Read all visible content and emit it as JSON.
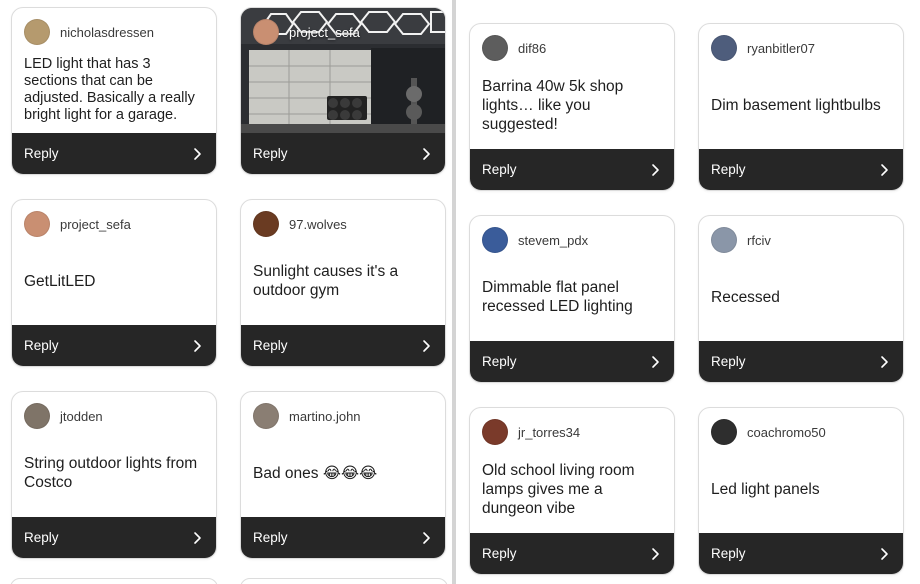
{
  "left_cards": [
    {
      "user": "nicholasdressen",
      "text": "LED light that has 3 sections that can be adjusted. Basically a really bright light for a garage.",
      "avatar_color": "#b59a6e",
      "avatar_icon": "user-avatar"
    },
    {
      "user": "project_sefa",
      "text": "",
      "avatar_color": "#c98f72",
      "avatar_icon": "user-avatar",
      "photo": "garage-gym-photo"
    },
    {
      "user": "project_sefa",
      "text": "GetLitLED",
      "avatar_color": "#c98f72",
      "avatar_icon": "user-avatar"
    },
    {
      "user": "97.wolves",
      "text": "Sunlight causes it's a outdoor gym",
      "avatar_color": "#6a3b22",
      "avatar_icon": "user-avatar"
    },
    {
      "user": "jtodden",
      "text": "String outdoor lights from Costco",
      "avatar_color": "#7f7468",
      "avatar_icon": "user-avatar"
    },
    {
      "user": "martino.john",
      "text": "Bad ones 😂😂😂",
      "avatar_color": "#8a7e73",
      "avatar_icon": "user-avatar"
    }
  ],
  "right_cards": [
    {
      "user": "dif86",
      "text": "Barrina 40w 5k shop lights… like you suggested!",
      "avatar_color": "#5d5d5d",
      "avatar_icon": "user-avatar"
    },
    {
      "user": "ryanbitler07",
      "text": "Dim basement lightbulbs",
      "avatar_color": "#4e5d7c",
      "avatar_icon": "user-avatar"
    },
    {
      "user": "stevem_pdx",
      "text": "Dimmable flat panel recessed LED lighting",
      "avatar_color": "#3a5c9a",
      "avatar_icon": "user-avatar"
    },
    {
      "user": "rfciv",
      "text": "Recessed",
      "avatar_color": "#8a96a8",
      "avatar_icon": "user-avatar"
    },
    {
      "user": "jr_torres34",
      "text": "Old school living room lamps gives me a dungeon vibe",
      "avatar_color": "#7a3a2a",
      "avatar_icon": "user-avatar"
    },
    {
      "user": "coachromo50",
      "text": "Led light panels",
      "avatar_color": "#2e2e2e",
      "avatar_icon": "user-avatar"
    }
  ],
  "reply_label": "Reply",
  "colors": {
    "reply_bar": "#262626",
    "card_border": "#dcdcdc",
    "divider": "#d4d4d4"
  }
}
